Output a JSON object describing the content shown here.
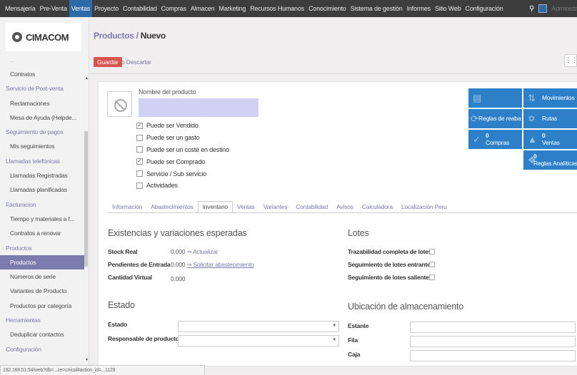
{
  "topbar": {
    "menu": [
      "Mensajería",
      "Pre-Venta",
      "Ventas",
      "Proyecto",
      "Contabilidad",
      "Compras",
      "Almacen",
      "Marketing",
      "Recursos Humanos",
      "Conocimiento",
      "Sistema de gestión",
      "Informes",
      "Sitio Web",
      "Configuración"
    ],
    "active_menu": "Ventas",
    "search_icon": "search-icon",
    "user": "Administr"
  },
  "logo": {
    "text": "CIMACOM"
  },
  "sidebar": {
    "cut_top": "...",
    "items": [
      {
        "type": "item",
        "label": "Contratos"
      },
      {
        "type": "head",
        "label": "Servicio de Post-venta"
      },
      {
        "type": "item",
        "label": "Reclamaciones"
      },
      {
        "type": "item",
        "label": "Mesa de Ayuda (Helpde..."
      },
      {
        "type": "head",
        "label": "Seguimiento de pagos"
      },
      {
        "type": "item",
        "label": "Mis seguimientos"
      },
      {
        "type": "head",
        "label": "Llamadas telefónicas"
      },
      {
        "type": "item",
        "label": "Llamadas Registradas"
      },
      {
        "type": "item",
        "label": "Llamadas planificadas"
      },
      {
        "type": "head",
        "label": "Facturacion"
      },
      {
        "type": "item",
        "label": "Tiempo y materiales a f..."
      },
      {
        "type": "item",
        "label": "Contratos a renovar"
      },
      {
        "type": "head",
        "label": "Productos"
      },
      {
        "type": "item",
        "label": "Productos",
        "active": true
      },
      {
        "type": "item",
        "label": "Números de serie"
      },
      {
        "type": "item",
        "label": "Variantes de Producto"
      },
      {
        "type": "item",
        "label": "Productos por categoría"
      },
      {
        "type": "head",
        "label": "Herramientas"
      },
      {
        "type": "item",
        "label": "Deduplicar contactos"
      },
      {
        "type": "head",
        "label": "Configuración"
      }
    ]
  },
  "breadcrumb": {
    "parent": "Productos",
    "sep": " / ",
    "current": "Nuevo"
  },
  "buttons": {
    "save": "Guardar",
    "or": "o",
    "discard": "Descartar"
  },
  "form": {
    "name_label": "Nombre del producto",
    "name_value": "",
    "checkboxes": [
      {
        "label": "Puede ser Vendido",
        "checked": true
      },
      {
        "label": "Puede ser un gasto",
        "checked": false
      },
      {
        "label": "Puede ser un coste en destino",
        "checked": false
      },
      {
        "label": "Puede ser Comprado",
        "checked": true
      },
      {
        "label": "Servicio / Sub servicio",
        "checked": false
      },
      {
        "label": "Actividades",
        "checked": false
      }
    ]
  },
  "stat_buttons": {
    "blank_icon": "document-icon",
    "movimientos": "Movimientos",
    "reglas": "Reglas de reabas",
    "rutas": "Rutas",
    "compras_count": "0",
    "compras": "Compras",
    "ventas_count": "0",
    "ventas": "Ventas",
    "analiticas_count": "0",
    "analiticas": "Reglas Analíticas",
    "color": "#2d80c8"
  },
  "tabs": [
    "Información",
    "Abastecimientos",
    "Inventario",
    "Ventas",
    "Variantes",
    "Contabilidad",
    "Avisos",
    "Calculadora",
    "Localización Peru"
  ],
  "active_tab": "Inventario",
  "inventory": {
    "title": "Existencias y variaciones esperadas",
    "stock_real_label": "Stock Real",
    "stock_real_value": "0.000",
    "stock_real_link": "⇒ Actualizar",
    "pendientes_label": "Pendientes de Entrada",
    "pendientes_value": "0.000",
    "pendientes_link": "⇒ Solicitar abastecimiento",
    "virtual_label": "Cantidad Virtual",
    "virtual_value": "0.000"
  },
  "lotes": {
    "title": "Lotes",
    "rows": [
      "Trazabilidad completa de lotes",
      "Seguimiento de lotes entrantes",
      "Seguimiento de lotes salientes"
    ]
  },
  "estado": {
    "title": "Estado",
    "estado_label": "Estado",
    "responsable_label": "Responsable de producto"
  },
  "ubicacion": {
    "title": "Ubicación de almacenamiento",
    "estante": "Estante",
    "fila": "Fila",
    "caja": "Caja"
  },
  "statusbar": {
    "url": "192.168.51.54/web?db=...ce=cnical#action_id=...1129"
  }
}
